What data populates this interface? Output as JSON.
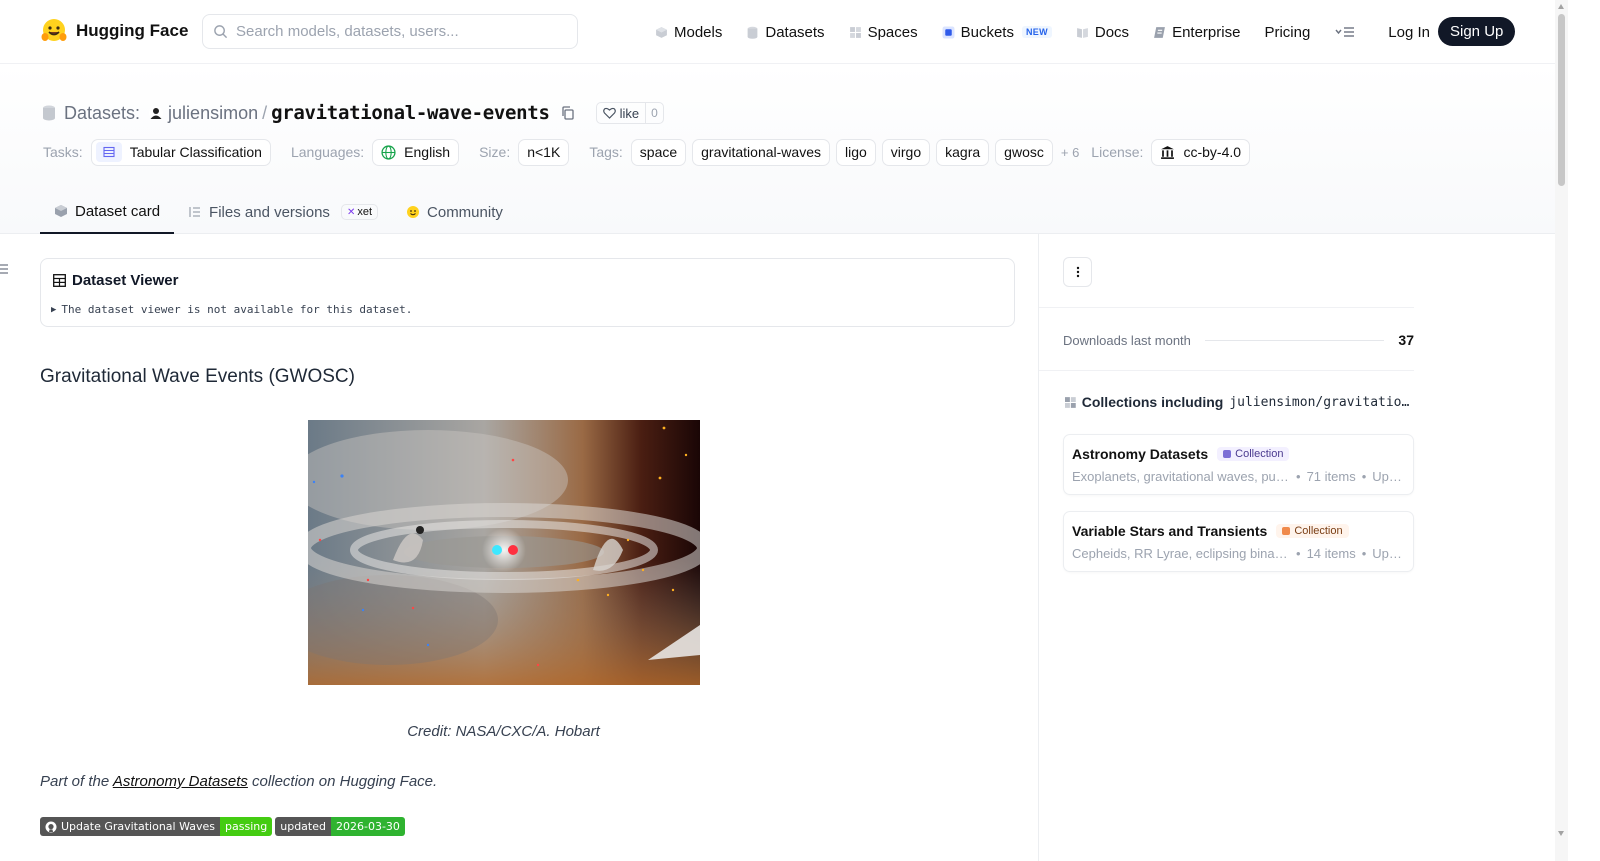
{
  "nav": {
    "brand": "Hugging Face",
    "search_placeholder": "Search models, datasets, users...",
    "links": [
      {
        "label": "Models",
        "icon": "models-icon"
      },
      {
        "label": "Datasets",
        "icon": "datasets-icon"
      },
      {
        "label": "Spaces",
        "icon": "spaces-icon"
      },
      {
        "label": "Buckets",
        "icon": "buckets-icon",
        "badge": "NEW"
      },
      {
        "label": "Docs",
        "icon": "docs-icon"
      },
      {
        "label": "Enterprise",
        "icon": "enterprise-icon"
      },
      {
        "label": "Pricing"
      }
    ],
    "login": "Log In",
    "signup": "Sign Up"
  },
  "repo": {
    "type_label": "Datasets:",
    "owner": "juliensimon",
    "name": "gravitational-wave-events",
    "like_label": "like",
    "like_count": "0"
  },
  "meta": {
    "tasks_label": "Tasks:",
    "task": "Tabular Classification",
    "languages_label": "Languages:",
    "language": "English",
    "size_label": "Size:",
    "size": "n<1K",
    "tags_label": "Tags:",
    "tags": [
      "space",
      "gravitational-waves",
      "ligo",
      "virgo",
      "kagra",
      "gwosc"
    ],
    "more_tags": "+ 6",
    "license_label": "License:",
    "license": "cc-by-4.0"
  },
  "tabs": {
    "card": "Dataset card",
    "files": "Files and versions",
    "xet": "xet",
    "community": "Community"
  },
  "viewer": {
    "title": "Dataset Viewer",
    "message": "The dataset viewer is not available for this dataset."
  },
  "card": {
    "heading": "Gravitational Wave Events (GWOSC)",
    "credit": "Credit: NASA/CXC/A. Hobart",
    "part_prefix": "Part of the ",
    "part_link": "Astronomy Datasets",
    "part_suffix": " collection on Hugging Face.",
    "badges": [
      {
        "left": "Update Gravitational Waves",
        "right": "passing",
        "right_color": "#44cc11"
      },
      {
        "left": "updated",
        "right": "2026-03-30",
        "right_color": "#2fb330"
      }
    ]
  },
  "sidebar": {
    "downloads_label": "Downloads last month",
    "downloads_value": "37",
    "collections_label": "Collections including",
    "collections_repo": "juliensimon/gravitation…",
    "collections": [
      {
        "name": "Astronomy Datasets",
        "tag": "Collection",
        "desc": "Exoplanets, gravitational waves, pul…",
        "items": "71 items",
        "updated": "Up…",
        "color": "#7c6fd6"
      },
      {
        "name": "Variable Stars and Transients",
        "tag": "Collection",
        "desc": "Cepheids, RR Lyrae, eclipsing binari…",
        "items": "14 items",
        "updated": "Up…",
        "color": "#f08a4b"
      }
    ]
  }
}
